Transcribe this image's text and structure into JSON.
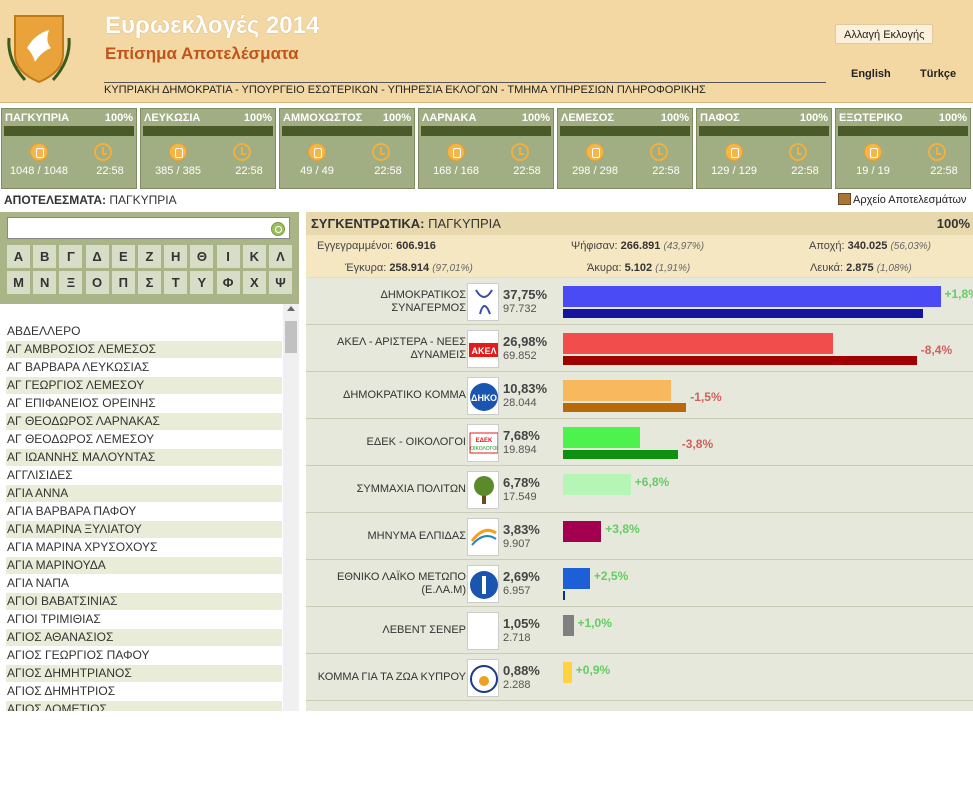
{
  "header": {
    "title": "Ευρωεκλογές 2014",
    "subtitle": "Επίσημα Αποτελέσματα",
    "ministry": "ΚΥΠΡΙΑΚΗ ΔΗΜΟΚΡΑΤΙΑ - ΥΠΟΥΡΓΕΙΟ ΕΣΩΤΕΡΙΚΩΝ - ΥΠΗΡΕΣΙΑ ΕΚΛΟΓΩΝ - ΤΜΗΜΑ ΥΠΗΡΕΣΙΩΝ ΠΛΗΡΟΦΟΡΙΚΗΣ",
    "change_election": "Αλλαγή Εκλογής",
    "lang_en": "English",
    "lang_tr": "Türkçe"
  },
  "districts": [
    {
      "name": "ΠΑΓΚΥΠΡΙΑ",
      "pct": "100%",
      "count": "1048 / 1048",
      "time": "22:58"
    },
    {
      "name": "ΛΕΥΚΩΣΙΑ",
      "pct": "100%",
      "count": "385 / 385",
      "time": "22:58"
    },
    {
      "name": "ΑΜΜΟΧΩΣΤΟΣ",
      "pct": "100%",
      "count": "49 / 49",
      "time": "22:58"
    },
    {
      "name": "ΛΑΡΝΑΚΑ",
      "pct": "100%",
      "count": "168 / 168",
      "time": "22:58"
    },
    {
      "name": "ΛΕΜΕΣΟΣ",
      "pct": "100%",
      "count": "298 / 298",
      "time": "22:58"
    },
    {
      "name": "ΠΑΦΟΣ",
      "pct": "100%",
      "count": "129 / 129",
      "time": "22:58"
    },
    {
      "name": "ΕΞΩΤΕΡΙΚΟ",
      "pct": "100%",
      "count": "19 / 19",
      "time": "22:58"
    }
  ],
  "results_label": "ΑΠΟΤΕΛΕΣΜΑΤΑ:",
  "results_value": "ΠΑΓΚΥΠΡΙΑ",
  "archive": "Αρχείο Αποτελεσμάτων",
  "letters": [
    "Α",
    "Β",
    "Γ",
    "Δ",
    "Ε",
    "Ζ",
    "Η",
    "Θ",
    "Ι",
    "Κ",
    "Λ",
    "Μ",
    "Ν",
    "Ξ",
    "Ο",
    "Π",
    "Σ",
    "Τ",
    "Υ",
    "Φ",
    "Χ",
    "Ψ"
  ],
  "locations": [
    "ΑΒΔΕΛΛΕΡΟ",
    "ΑΓ ΑΜΒΡΟΣΙΟΣ ΛΕΜΕΣΟΣ",
    "ΑΓ ΒΑΡΒΑΡΑ ΛΕΥΚΩΣΙΑΣ",
    "ΑΓ ΓΕΩΡΓΙΟΣ ΛΕΜΕΣΟΥ",
    "ΑΓ ΕΠΙΦΑΝΕΙΟΣ ΟΡΕΙΝΗΣ",
    "ΑΓ ΘΕΟΔΩΡΟΣ ΛΑΡΝΑΚΑΣ",
    "ΑΓ ΘΕΟΔΩΡΟΣ ΛΕΜΕΣΟΥ",
    "ΑΓ ΙΩΑΝΝΗΣ ΜΑΛΟΥΝΤΑΣ",
    "ΑΓΓΛΙΣΙΔΕΣ",
    "ΑΓΙΑ ΑΝΝΑ",
    "ΑΓΙΑ ΒΑΡΒΑΡΑ ΠΑΦΟΥ",
    "ΑΓΙΑ ΜΑΡΙΝΑ ΞΥΛΙΑΤΟΥ",
    "ΑΓΙΑ ΜΑΡΙΝΑ ΧΡΥΣΟΧΟΥΣ",
    "ΑΓΙΑ ΜΑΡΙΝΟΥΔΑ",
    "ΑΓΙΑ ΝΑΠΑ",
    "ΑΓΙΟΙ ΒΑΒΑΤΣΙΝΙΑΣ",
    "ΑΓΙΟΙ ΤΡΙΜΙΘΙΑΣ",
    "ΑΓΙΟΣ ΑΘΑΝΑΣΙΟΣ",
    "ΑΓΙΟΣ ΓΕΩΡΓΙΟΣ ΠΑΦΟΥ",
    "ΑΓΙΟΣ ΔΗΜΗΤΡΙΑΝΟΣ",
    "ΑΓΙΟΣ ΔΗΜΗΤΡΙΟΣ",
    "ΑΓΙΟΣ ΔΟΜΕΤΙΟΣ"
  ],
  "summary": {
    "title_label": "ΣΥΓΚΕΝΤΡΩΤΙΚΑ:",
    "title_value": "ΠΑΓΚΥΠΡΙΑ",
    "pct": "100%",
    "registered_label": "Εγγεγραμμένοι:",
    "registered": "606.916",
    "voted_label": "Ψήφισαν:",
    "voted": "266.891",
    "voted_pct": "(43,97%)",
    "abstention_label": "Αποχή:",
    "abstention": "340.025",
    "abstention_pct": "(56,03%)",
    "valid_label": "Έγκυρα:",
    "valid": "258.914",
    "valid_pct": "(97,01%)",
    "invalid_label": "Άκυρα:",
    "invalid": "5.102",
    "invalid_pct": "(1,91%)",
    "blank_label": "Λευκά:",
    "blank": "2.875",
    "blank_pct": "(1,08%)"
  },
  "chart_data": {
    "type": "bar",
    "categories": [
      "ΔΗΜΟΚΡΑΤΙΚΟΣ ΣΥΝΑΓΕΡΜΟΣ",
      "ΑΚΕΛ - ΑΡΙΣΤΕΡΑ - ΝΕΕΣ ΔΥΝΑΜΕΙΣ",
      "ΔΗΜΟΚΡΑΤΙΚΟ ΚΟΜΜΑ",
      "ΕΔΕΚ - ΟΙΚΟΛΟΓΟΙ",
      "ΣΥΜΜΑΧΙΑ ΠΟΛΙΤΩΝ",
      "ΜΗΝΥΜΑ ΕΛΠΙΔΑΣ",
      "ΕΘΝΙΚΟ ΛΑΪΚΟ ΜΕΤΩΠΟ (Ε.ΛΑ.Μ)",
      "ΛΕΒΕΝΤ ΣΕΝΕΡ",
      "ΚΟΜΜΑ ΓΙΑ ΤΑ ΖΩΑ ΚΥΠΡΟΥ"
    ],
    "series": [
      {
        "values": [
          37.75,
          26.98,
          10.83,
          7.68,
          6.78,
          3.83,
          2.69,
          1.05,
          0.88
        ]
      },
      {
        "values": [
          35.95,
          35.38,
          12.33,
          11.48,
          0,
          0,
          0.19,
          0.05,
          0
        ]
      }
    ],
    "pct_labels": [
      "37,75%",
      "26,98%",
      "10,83%",
      "7,68%",
      "6,78%",
      "3,83%",
      "2,69%",
      "1,05%",
      "0,88%"
    ],
    "votes": [
      "97.732",
      "69.852",
      "28.044",
      "19.894",
      "17.549",
      "9.907",
      "6.957",
      "2.718",
      "2.288"
    ],
    "diffs": [
      "+1,8%",
      "-8,4%",
      "-1,5%",
      "-3,8%",
      "+6,8%",
      "+3,8%",
      "+2,5%",
      "+1,0%",
      "+0,9%"
    ],
    "colors_now": [
      "#4b4bf5",
      "#f24d4d",
      "#f7b85e",
      "#4df24d",
      "#b5f5b5",
      "#a3004f",
      "#1d5fd6",
      "#808080",
      "#ffd23f"
    ],
    "colors_prev": [
      "#14149e",
      "#a00000",
      "#b86a0a",
      "#109010",
      "#7ad07a",
      "#6a0033",
      "#0a2f8c",
      "#444444",
      "#c9a000"
    ],
    "diff_colors": {
      "positive": "#66cc66",
      "negative": "#d06060"
    },
    "xlim": [
      0,
      40
    ]
  }
}
